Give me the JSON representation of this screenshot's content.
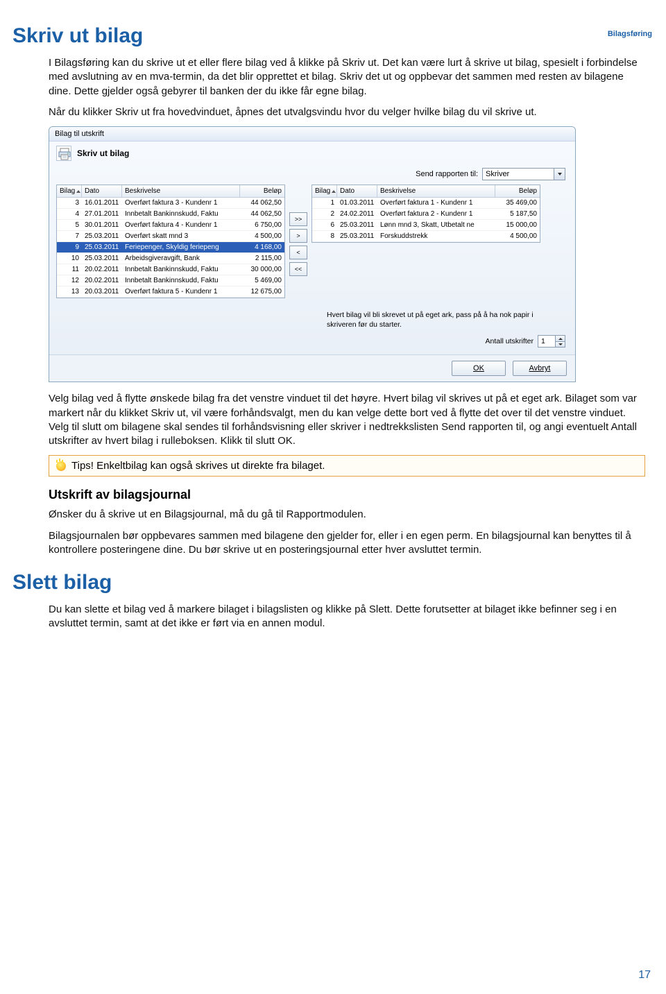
{
  "header_label": "Bilagsføring",
  "page_number": "17",
  "h1": "Skriv ut bilag",
  "para1_full": "I Bilagsføring kan du skrive ut et eller flere bilag ved å klikke på Skriv ut. Det kan være lurt å skrive ut bilag, spesielt i forbindelse med avslutning av en mva-termin, da det blir opprettet et bilag. Skriv det ut og oppbevar det sammen med resten av bilagene dine. Dette gjelder også gebyrer til banken der du ikke får egne bilag.",
  "para2_full": "Når du klikker Skriv ut fra hovedvinduet, åpnes det utvalgsvindu hvor du velger hvilke bilag du vil skrive ut.",
  "para3_full": "Velg bilag ved å flytte ønskede bilag fra det venstre vinduet til det høyre. Hvert bilag vil skrives ut på et eget ark. Bilaget som var markert når du klikket Skriv ut, vil være forhåndsvalgt, men du kan velge dette bort ved å flytte det over til det venstre vinduet. Velg til slutt om bilagene skal sendes til forhåndsvisning eller skriver i nedtrekkslisten Send rapporten til, og angi eventuelt Antall utskrifter av hvert bilag i rulleboksen. Klikk til slutt OK.",
  "tips_full": "Tips! Enkeltbilag kan også skrives ut direkte fra bilaget.",
  "h3": "Utskrift av bilagsjournal",
  "para4_full": "Ønsker du å skrive ut en Bilagsjournal, må du gå til Rapportmodulen.",
  "para5_full": "Bilagsjournalen bør oppbevares sammen med bilagene den gjelder for, eller i en egen perm. En bilagsjournal kan benyttes til å kontrollere posteringene dine. Du bør skrive ut en posteringsjournal etter hver avsluttet termin.",
  "h2": "Slett bilag",
  "para6_full": "Du kan slette et bilag ved å markere bilaget i bilagslisten og klikke på Slett. Dette forutsetter at bilaget ikke befinner seg i en avsluttet termin, samt at det ikke er ført via en annen modul.",
  "dialog": {
    "title": "Bilag til utskrift",
    "toolbar_label": "Skriv ut bilag",
    "send_label": "Send rapporten til:",
    "send_value": "Skriver",
    "cols": {
      "bilag": "Bilag",
      "dato": "Dato",
      "besk": "Beskrivelse",
      "belop": "Beløp"
    },
    "left_rows": [
      {
        "b": "3",
        "d": "16.01.2011",
        "t": "Overført faktura 3 - Kundenr 1",
        "a": "44 062,50"
      },
      {
        "b": "4",
        "d": "27.01.2011",
        "t": "Innbetalt Bankinnskudd, Faktu",
        "a": "44 062,50"
      },
      {
        "b": "5",
        "d": "30.01.2011",
        "t": "Overført faktura 4 - Kundenr 1",
        "a": "6 750,00"
      },
      {
        "b": "7",
        "d": "25.03.2011",
        "t": "Overført skatt mnd 3",
        "a": "4 500,00"
      },
      {
        "b": "9",
        "d": "25.03.2011",
        "t": "Feriepenger, Skyldig feriepeng",
        "a": "4 168,00",
        "selected": true
      },
      {
        "b": "10",
        "d": "25.03.2011",
        "t": "Arbeidsgiveravgift, Bank",
        "a": "2 115,00"
      },
      {
        "b": "11",
        "d": "20.02.2011",
        "t": "Innbetalt Bankinnskudd, Faktu",
        "a": "30 000,00"
      },
      {
        "b": "12",
        "d": "20.02.2011",
        "t": "Innbetalt Bankinnskudd, Faktu",
        "a": "5 469,00"
      },
      {
        "b": "13",
        "d": "20.03.2011",
        "t": "Overført faktura 5 - Kundenr 1",
        "a": "12 675,00"
      }
    ],
    "right_rows": [
      {
        "b": "1",
        "d": "01.03.2011",
        "t": "Overført faktura 1 - Kundenr 1",
        "a": "35 469,00"
      },
      {
        "b": "2",
        "d": "24.02.2011",
        "t": "Overført faktura 2 - Kundenr 1",
        "a": "5 187,50"
      },
      {
        "b": "6",
        "d": "25.03.2011",
        "t": "Lønn mnd 3, Skatt, Utbetalt ne",
        "a": "15 000,00"
      },
      {
        "b": "8",
        "d": "25.03.2011",
        "t": "Forskuddstrekk",
        "a": "4 500,00"
      }
    ],
    "move_all_right": ">>",
    "move_right": ">",
    "move_left": "<",
    "move_all_left": "<<",
    "info_text": "Hvert bilag vil bli skrevet ut på eget ark, pass på å ha nok papir i skriveren før du starter.",
    "antall_label": "Antall utskrifter",
    "antall_value": "1",
    "ok": "OK",
    "cancel": "Avbryt"
  }
}
